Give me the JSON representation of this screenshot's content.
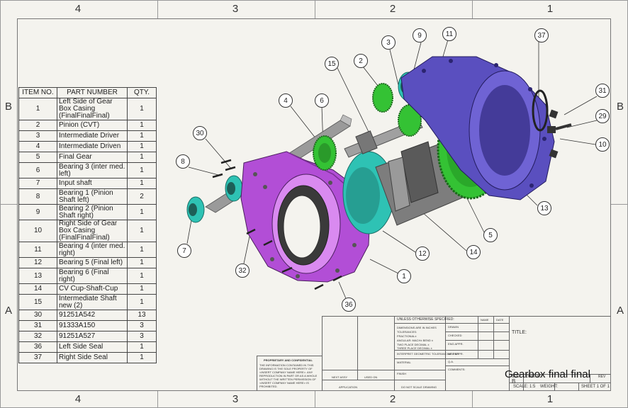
{
  "zones": {
    "top": [
      "4",
      "3",
      "2",
      "1"
    ],
    "bottom": [
      "4",
      "3",
      "2",
      "1"
    ],
    "left": [
      "B",
      "A"
    ],
    "right": [
      "B",
      "A"
    ]
  },
  "bom": {
    "headers": [
      "ITEM NO.",
      "PART NUMBER",
      "QTY."
    ],
    "rows": [
      {
        "item": "1",
        "part": "Left Side of Gear Box Casing (FinalFinalFinal)",
        "qty": "1"
      },
      {
        "item": "2",
        "part": "Pinion (CVT)",
        "qty": "1"
      },
      {
        "item": "3",
        "part": "Intermediate Driver",
        "qty": "1"
      },
      {
        "item": "4",
        "part": "Intermediate Driven",
        "qty": "1"
      },
      {
        "item": "5",
        "part": "Final Gear",
        "qty": "1"
      },
      {
        "item": "6",
        "part": "Bearing 3 (inter med. left)",
        "qty": "1"
      },
      {
        "item": "7",
        "part": "Input shaft",
        "qty": "1"
      },
      {
        "item": "8",
        "part": "Bearing 1 (Pinion Shaft left)",
        "qty": "2"
      },
      {
        "item": "9",
        "part": "Bearing 2 (Pinion Shaft right)",
        "qty": "1"
      },
      {
        "item": "10",
        "part": "Right Side of Gear Box Casing (FinalFinalFinal)",
        "qty": "1"
      },
      {
        "item": "11",
        "part": "Bearing 4 (inter med. right)",
        "qty": "1"
      },
      {
        "item": "12",
        "part": "Bearing 5 (Final left)",
        "qty": "1"
      },
      {
        "item": "13",
        "part": "Bearing 6 (Final right)",
        "qty": "1"
      },
      {
        "item": "14",
        "part": "CV Cup-Shaft-Cup",
        "qty": "1"
      },
      {
        "item": "15",
        "part": "Intermediate Shaft new (2)",
        "qty": "1"
      },
      {
        "item": "30",
        "part": "91251A542",
        "qty": "13"
      },
      {
        "item": "31",
        "part": "91333A150",
        "qty": "3"
      },
      {
        "item": "32",
        "part": "91251A527",
        "qty": "3"
      },
      {
        "item": "36",
        "part": "Left Side Seal",
        "qty": "1"
      },
      {
        "item": "37",
        "part": "Right Side Seal",
        "qty": "1"
      }
    ]
  },
  "callouts": [
    "30",
    "8",
    "7",
    "4",
    "6",
    "15",
    "2",
    "3",
    "9",
    "11",
    "37",
    "31",
    "29",
    "10",
    "13",
    "5",
    "14",
    "12",
    "1",
    "32",
    "36"
  ],
  "title_block": {
    "unless": "UNLESS OTHERWISE SPECIFIED:",
    "name": "NAME",
    "date": "DATE",
    "dims": "DIMENSIONS ARE IN INCHES",
    "tolerances": "TOLERANCES:",
    "fractional": "FRACTIONAL±",
    "angular": "ANGULAR: MACH±   BEND ±",
    "two_place": "TWO PLACE DECIMAL   ±",
    "three_place": "THREE PLACE DECIMAL   ±",
    "drawn": "DRAWN",
    "checked": "CHECKED",
    "eng_appr": "ENG APPR.",
    "mfg_appr": "MFG APPR.",
    "qa": "Q.A.",
    "comments": "COMMENTS:",
    "interpret": "INTERPRET GEOMETRIC TOLERANCING PER:",
    "material": "MATERIAL",
    "finish": "FINISH",
    "next_assy": "NEXT ASSY",
    "used_on": "USED ON",
    "application": "APPLICATION",
    "do_not_scale": "DO NOT SCALE DRAWING",
    "proprietary_title": "PROPRIETARY AND CONFIDENTIAL",
    "proprietary_text": "THE INFORMATION CONTAINED IN THIS DRAWING IS THE SOLE PROPERTY OF <INSERT COMPANY NAME HERE>. ANY REPRODUCTION IN PART OR AS A WHOLE WITHOUT THE WRITTEN PERMISSION OF <INSERT COMPANY NAME HERE> IS PROHIBITED.",
    "title_label": "TITLE:",
    "size_label": "SIZE",
    "size_value": "B",
    "dwg_no_label": "DWG. NO.",
    "rev_label": "REV",
    "dwg_title": "Gearbox final final",
    "scale": "SCALE: 1:5",
    "weight": "WEIGHT:",
    "sheet": "SHEET 1 OF 1"
  },
  "colors": {
    "left_casing": "#b24ed6",
    "right_casing": "#5a4fbf",
    "gear": "#34c234",
    "bearing": "#2ec2b4",
    "shaft": "#8a8a8a"
  }
}
